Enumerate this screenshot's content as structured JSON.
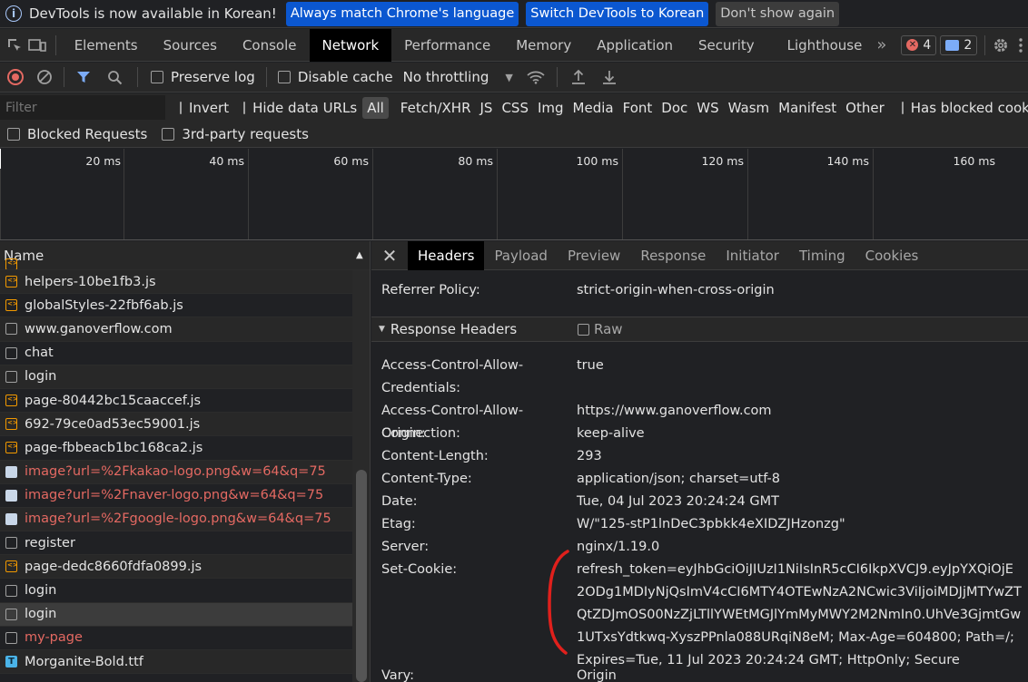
{
  "infobar": {
    "message": "DevTools is now available in Korean!",
    "btn_match": "Always match Chrome's language",
    "btn_switch": "Switch DevTools to Korean",
    "btn_dismiss": "Don't show again"
  },
  "tabs": [
    "Elements",
    "Sources",
    "Console",
    "Network",
    "Performance",
    "Memory",
    "Application",
    "Security",
    "Lighthouse"
  ],
  "active_tab": "Network",
  "badges": {
    "errors": "4",
    "messages": "2"
  },
  "toolbar": {
    "preserve_log": "Preserve log",
    "disable_cache": "Disable cache",
    "throttling": "No throttling"
  },
  "filter": {
    "placeholder": "Filter",
    "invert": "Invert",
    "hide_data_urls": "Hide data URLs",
    "types": [
      "All",
      "Fetch/XHR",
      "JS",
      "CSS",
      "Img",
      "Media",
      "Font",
      "Doc",
      "WS",
      "Wasm",
      "Manifest",
      "Other"
    ],
    "has_blocked": "Has blocked cookies",
    "blocked_requests": "Blocked Requests",
    "third_party": "3rd-party requests"
  },
  "timeline": [
    "20 ms",
    "40 ms",
    "60 ms",
    "80 ms",
    "100 ms",
    "120 ms",
    "140 ms",
    "160 ms"
  ],
  "list": {
    "header": "Name",
    "rows": [
      {
        "icon": "js",
        "name": "helpers-10be1fb3.js",
        "err": false
      },
      {
        "icon": "js",
        "name": "globalStyles-22fbf6ab.js",
        "err": false
      },
      {
        "icon": "doc",
        "name": "www.ganoverflow.com",
        "err": false
      },
      {
        "icon": "doc",
        "name": "chat",
        "err": false
      },
      {
        "icon": "doc",
        "name": "login",
        "err": false
      },
      {
        "icon": "js",
        "name": "page-80442bc15caaccef.js",
        "err": false
      },
      {
        "icon": "js",
        "name": "692-79ce0ad53ec59001.js",
        "err": false
      },
      {
        "icon": "js",
        "name": "page-fbbeacb1bc168ca2.js",
        "err": false
      },
      {
        "icon": "img",
        "name": "image?url=%2Fkakao-logo.png&w=64&q=75",
        "err": true
      },
      {
        "icon": "img",
        "name": "image?url=%2Fnaver-logo.png&w=64&q=75",
        "err": true
      },
      {
        "icon": "img",
        "name": "image?url=%2Fgoogle-logo.png&w=64&q=75",
        "err": true
      },
      {
        "icon": "doc",
        "name": "register",
        "err": false
      },
      {
        "icon": "js",
        "name": "page-dedc8660fdfa0899.js",
        "err": false
      },
      {
        "icon": "doc",
        "name": "login",
        "err": false
      },
      {
        "icon": "doc",
        "name": "login",
        "err": false,
        "selected": true
      },
      {
        "icon": "doc",
        "name": "my-page",
        "err": true
      },
      {
        "icon": "font",
        "name": "Morganite-Bold.ttf",
        "err": false
      }
    ]
  },
  "details": {
    "tabs": [
      "Headers",
      "Payload",
      "Preview",
      "Response",
      "Initiator",
      "Timing",
      "Cookies"
    ],
    "referrer_policy": {
      "k": "Referrer Policy:",
      "v": "strict-origin-when-cross-origin"
    },
    "response_headers_title": "Response Headers",
    "raw_label": "Raw",
    "headers": [
      {
        "k": "Access-Control-Allow-Credentials:",
        "v": "true"
      },
      {
        "k": "Access-Control-Allow-Origin:",
        "v": "https://www.ganoverflow.com"
      },
      {
        "k": "Connection:",
        "v": "keep-alive"
      },
      {
        "k": "Content-Length:",
        "v": "293"
      },
      {
        "k": "Content-Type:",
        "v": "application/json; charset=utf-8"
      },
      {
        "k": "Date:",
        "v": "Tue, 04 Jul 2023 20:24:24 GMT"
      },
      {
        "k": "Etag:",
        "v": "W/\"125-stP1lnDeC3pbkk4eXIDZJHzonzg\""
      },
      {
        "k": "Server:",
        "v": "nginx/1.19.0"
      },
      {
        "k": "Set-Cookie:",
        "v": "refresh_token=eyJhbGciOiJIUzI1NiIsInR5cCI6IkpXVCJ9.eyJpYXQiOjE2ODg1MDIyNjQsImV4cCI6MTY4OTEwNzA2NCwic3ViIjoiMDJjMTYwZTQtZDJmOS00NzZjLTllYWEtMGJlYmMyMWY2M2NmIn0.UhVe3GjmtGw1UTxsYdtkwq-XyszPPnla088URqiN8eM; Max-Age=604800; Path=/; Expires=Tue, 11 Jul 2023 20:24:24 GMT; HttpOnly; Secure"
      },
      {
        "k": "Vary:",
        "v": "Origin"
      }
    ]
  },
  "colors": {
    "accent": "#0b57d0",
    "error": "#e46962",
    "annotation": "#e0201c"
  }
}
